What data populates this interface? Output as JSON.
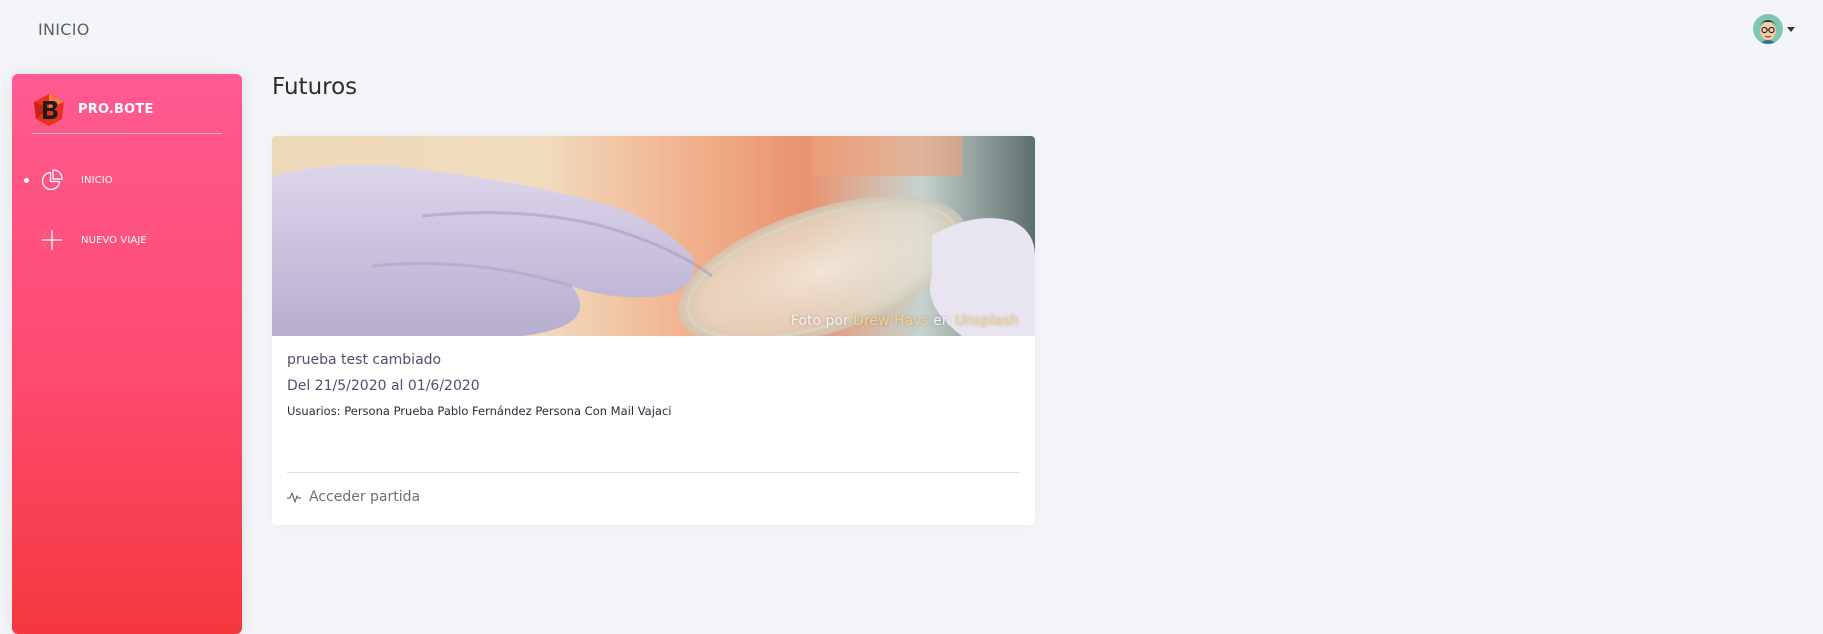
{
  "header": {
    "title": "INICIO"
  },
  "sidebar": {
    "brand": "PRO.BOTE",
    "items": [
      {
        "label": "INICIO",
        "icon": "pie-chart-icon",
        "active": true
      },
      {
        "label": "NUEVO VIAJE",
        "icon": "plus-icon",
        "active": false
      }
    ]
  },
  "main": {
    "title": "Futuros",
    "cards": [
      {
        "photo_credit": {
          "prefix": "Foto por",
          "author": "Drew Hays",
          "joiner": "en",
          "source": "Unsplash"
        },
        "name": "prueba test cambiado",
        "dates": "Del 21/5/2020 al 01/6/2020",
        "users": "Usuarios: Persona Prueba Pablo Fernández Persona Con Mail Vajaci",
        "action_label": "Acceder partida",
        "action_icon": "activity-icon"
      }
    ]
  },
  "colors": {
    "sidebar_top": "#ff5a92",
    "sidebar_bottom": "#f5383e",
    "background": "#f4f5f8",
    "credit_link": "#f5d28c"
  }
}
